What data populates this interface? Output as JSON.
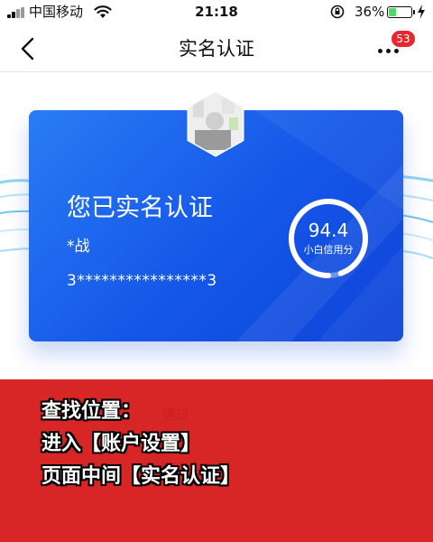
{
  "status_bar": {
    "carrier": "中国移动",
    "time": "21:18",
    "battery_percent": "36%",
    "battery_level": 0.36
  },
  "nav": {
    "title": "实名认证",
    "back_icon": "chevron-left-icon",
    "more_icon": "more-dots-icon",
    "badge_count": "53"
  },
  "card": {
    "heading": "您已实名认证",
    "name": "*战",
    "id_number": "3****************3",
    "score": "94.4",
    "score_label": "小白信用分",
    "score_fraction": 0.944
  },
  "hidden_content": {
    "status_text": "通过"
  },
  "annotation": {
    "lines": [
      "查找位置：",
      "进入【账户设置】",
      "页面中间【实名认证】"
    ]
  },
  "colors": {
    "card_blue": "#1456e8",
    "badge_red": "#e8262d",
    "overlay_red": "#d61818",
    "battery_green": "#4cd964"
  }
}
